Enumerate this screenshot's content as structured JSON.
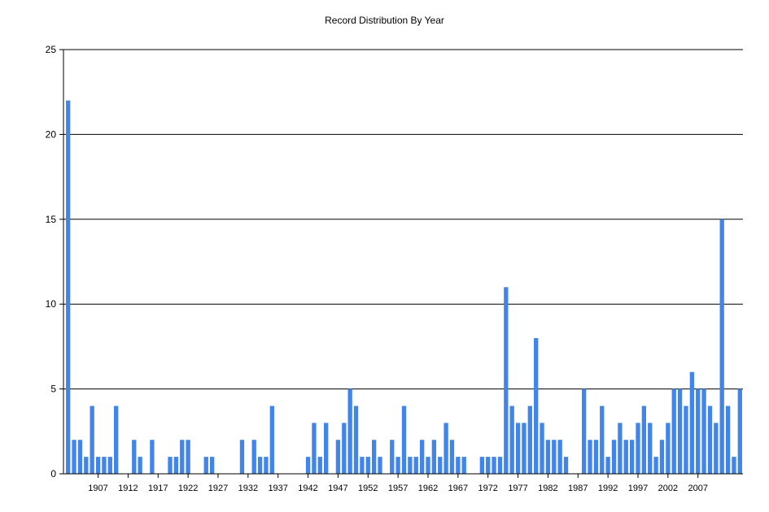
{
  "chart_data": {
    "type": "bar",
    "title": "Record Distribution By Year",
    "xlabel": "",
    "ylabel": "",
    "ylim": [
      0,
      25
    ],
    "y_ticks": [
      0,
      5,
      10,
      15,
      20,
      25
    ],
    "x_tick_labels": [
      1907,
      1912,
      1917,
      1922,
      1927,
      1932,
      1937,
      1942,
      1947,
      1952,
      1957,
      1962,
      1967,
      1972,
      1977,
      1982,
      1987,
      1992,
      1997,
      2002,
      2007
    ],
    "x_start": 1902,
    "grid": "horizontal",
    "bar_color": "#4285e8",
    "values": [
      22,
      2,
      2,
      1,
      4,
      1,
      1,
      1,
      4,
      0,
      0,
      2,
      1,
      0,
      2,
      0,
      0,
      1,
      1,
      2,
      2,
      0,
      0,
      1,
      1,
      0,
      0,
      0,
      0,
      2,
      0,
      2,
      1,
      1,
      4,
      0,
      0,
      0,
      0,
      0,
      1,
      3,
      1,
      3,
      0,
      2,
      3,
      5,
      4,
      1,
      1,
      2,
      1,
      0,
      2,
      1,
      4,
      1,
      1,
      2,
      1,
      2,
      1,
      3,
      2,
      1,
      1,
      0,
      0,
      1,
      1,
      1,
      1,
      11,
      4,
      3,
      3,
      4,
      8,
      3,
      2,
      2,
      2,
      1,
      0,
      0,
      5,
      2,
      2,
      4,
      1,
      2,
      3,
      2,
      2,
      3,
      4,
      3,
      1,
      2,
      3,
      5,
      5,
      4,
      6,
      5,
      5,
      4,
      3,
      15,
      4,
      1,
      5
    ]
  }
}
